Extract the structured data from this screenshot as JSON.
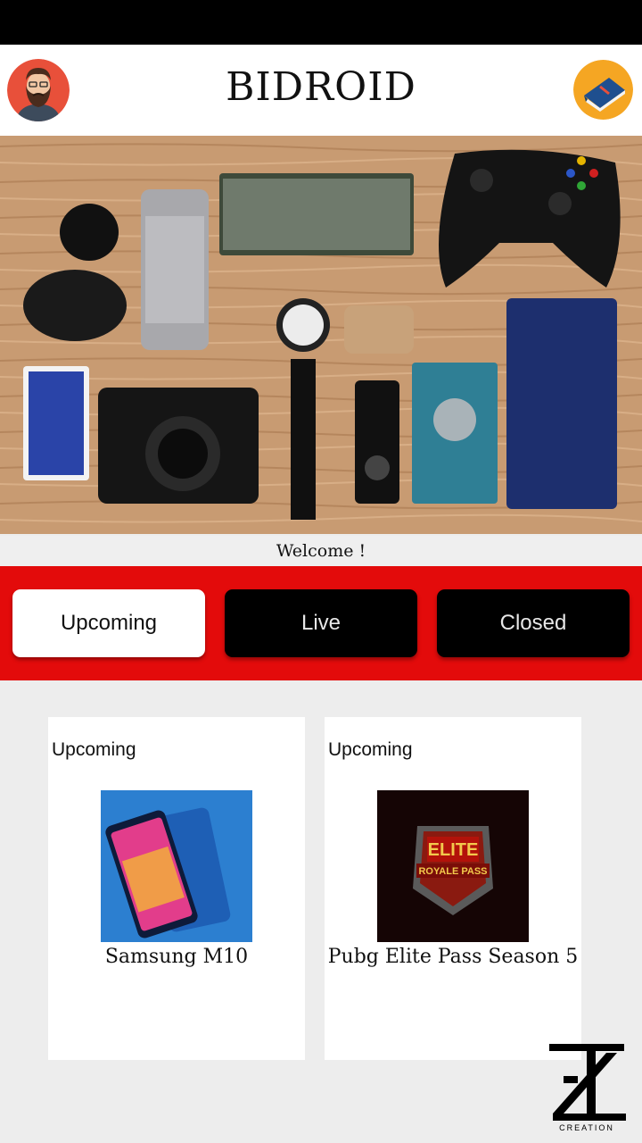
{
  "app": {
    "title": "BIDROID",
    "avatar_icon": "bearded-man-avatar-icon",
    "book_icon": "book-icon"
  },
  "hero": {
    "image": "gadgets-flatlay"
  },
  "welcome_text": "Welcome !",
  "tabs": [
    {
      "label": "Upcoming",
      "active": true
    },
    {
      "label": "Live",
      "active": false
    },
    {
      "label": "Closed",
      "active": false
    }
  ],
  "auctions": [
    {
      "status": "Upcoming",
      "name": "Samsung M10"
    },
    {
      "status": "Upcoming",
      "name": "Pubg Elite Pass Season 5"
    }
  ],
  "watermark": {
    "text": "CREATION"
  },
  "colors": {
    "accent_red": "#e30b0b",
    "tab_active_bg": "#ffffff",
    "tab_inactive_bg": "#000000",
    "avatar_bg": "#e8503a",
    "book_bg": "#f5a623"
  }
}
